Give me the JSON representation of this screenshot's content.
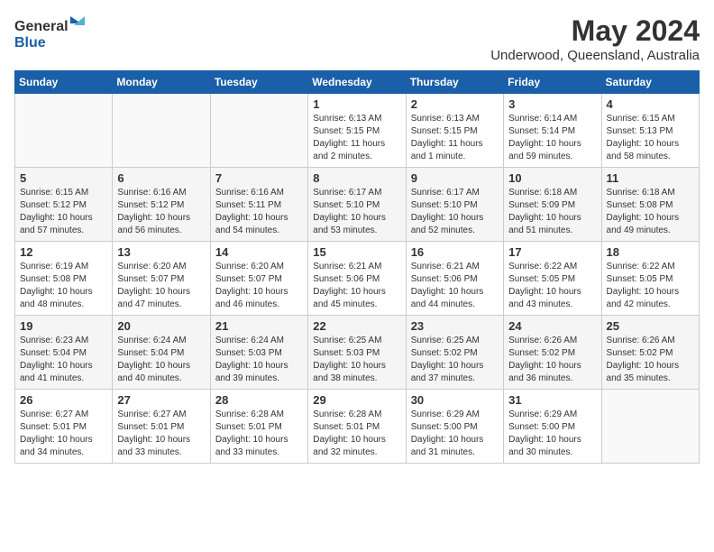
{
  "header": {
    "logo_general": "General",
    "logo_blue": "Blue",
    "month_year": "May 2024",
    "location": "Underwood, Queensland, Australia"
  },
  "days_of_week": [
    "Sunday",
    "Monday",
    "Tuesday",
    "Wednesday",
    "Thursday",
    "Friday",
    "Saturday"
  ],
  "weeks": [
    [
      {
        "day": "",
        "info": ""
      },
      {
        "day": "",
        "info": ""
      },
      {
        "day": "",
        "info": ""
      },
      {
        "day": "1",
        "info": "Sunrise: 6:13 AM\nSunset: 5:15 PM\nDaylight: 11 hours\nand 2 minutes."
      },
      {
        "day": "2",
        "info": "Sunrise: 6:13 AM\nSunset: 5:15 PM\nDaylight: 11 hours\nand 1 minute."
      },
      {
        "day": "3",
        "info": "Sunrise: 6:14 AM\nSunset: 5:14 PM\nDaylight: 10 hours\nand 59 minutes."
      },
      {
        "day": "4",
        "info": "Sunrise: 6:15 AM\nSunset: 5:13 PM\nDaylight: 10 hours\nand 58 minutes."
      }
    ],
    [
      {
        "day": "5",
        "info": "Sunrise: 6:15 AM\nSunset: 5:12 PM\nDaylight: 10 hours\nand 57 minutes."
      },
      {
        "day": "6",
        "info": "Sunrise: 6:16 AM\nSunset: 5:12 PM\nDaylight: 10 hours\nand 56 minutes."
      },
      {
        "day": "7",
        "info": "Sunrise: 6:16 AM\nSunset: 5:11 PM\nDaylight: 10 hours\nand 54 minutes."
      },
      {
        "day": "8",
        "info": "Sunrise: 6:17 AM\nSunset: 5:10 PM\nDaylight: 10 hours\nand 53 minutes."
      },
      {
        "day": "9",
        "info": "Sunrise: 6:17 AM\nSunset: 5:10 PM\nDaylight: 10 hours\nand 52 minutes."
      },
      {
        "day": "10",
        "info": "Sunrise: 6:18 AM\nSunset: 5:09 PM\nDaylight: 10 hours\nand 51 minutes."
      },
      {
        "day": "11",
        "info": "Sunrise: 6:18 AM\nSunset: 5:08 PM\nDaylight: 10 hours\nand 49 minutes."
      }
    ],
    [
      {
        "day": "12",
        "info": "Sunrise: 6:19 AM\nSunset: 5:08 PM\nDaylight: 10 hours\nand 48 minutes."
      },
      {
        "day": "13",
        "info": "Sunrise: 6:20 AM\nSunset: 5:07 PM\nDaylight: 10 hours\nand 47 minutes."
      },
      {
        "day": "14",
        "info": "Sunrise: 6:20 AM\nSunset: 5:07 PM\nDaylight: 10 hours\nand 46 minutes."
      },
      {
        "day": "15",
        "info": "Sunrise: 6:21 AM\nSunset: 5:06 PM\nDaylight: 10 hours\nand 45 minutes."
      },
      {
        "day": "16",
        "info": "Sunrise: 6:21 AM\nSunset: 5:06 PM\nDaylight: 10 hours\nand 44 minutes."
      },
      {
        "day": "17",
        "info": "Sunrise: 6:22 AM\nSunset: 5:05 PM\nDaylight: 10 hours\nand 43 minutes."
      },
      {
        "day": "18",
        "info": "Sunrise: 6:22 AM\nSunset: 5:05 PM\nDaylight: 10 hours\nand 42 minutes."
      }
    ],
    [
      {
        "day": "19",
        "info": "Sunrise: 6:23 AM\nSunset: 5:04 PM\nDaylight: 10 hours\nand 41 minutes."
      },
      {
        "day": "20",
        "info": "Sunrise: 6:24 AM\nSunset: 5:04 PM\nDaylight: 10 hours\nand 40 minutes."
      },
      {
        "day": "21",
        "info": "Sunrise: 6:24 AM\nSunset: 5:03 PM\nDaylight: 10 hours\nand 39 minutes."
      },
      {
        "day": "22",
        "info": "Sunrise: 6:25 AM\nSunset: 5:03 PM\nDaylight: 10 hours\nand 38 minutes."
      },
      {
        "day": "23",
        "info": "Sunrise: 6:25 AM\nSunset: 5:02 PM\nDaylight: 10 hours\nand 37 minutes."
      },
      {
        "day": "24",
        "info": "Sunrise: 6:26 AM\nSunset: 5:02 PM\nDaylight: 10 hours\nand 36 minutes."
      },
      {
        "day": "25",
        "info": "Sunrise: 6:26 AM\nSunset: 5:02 PM\nDaylight: 10 hours\nand 35 minutes."
      }
    ],
    [
      {
        "day": "26",
        "info": "Sunrise: 6:27 AM\nSunset: 5:01 PM\nDaylight: 10 hours\nand 34 minutes."
      },
      {
        "day": "27",
        "info": "Sunrise: 6:27 AM\nSunset: 5:01 PM\nDaylight: 10 hours\nand 33 minutes."
      },
      {
        "day": "28",
        "info": "Sunrise: 6:28 AM\nSunset: 5:01 PM\nDaylight: 10 hours\nand 33 minutes."
      },
      {
        "day": "29",
        "info": "Sunrise: 6:28 AM\nSunset: 5:01 PM\nDaylight: 10 hours\nand 32 minutes."
      },
      {
        "day": "30",
        "info": "Sunrise: 6:29 AM\nSunset: 5:00 PM\nDaylight: 10 hours\nand 31 minutes."
      },
      {
        "day": "31",
        "info": "Sunrise: 6:29 AM\nSunset: 5:00 PM\nDaylight: 10 hours\nand 30 minutes."
      },
      {
        "day": "",
        "info": ""
      }
    ]
  ]
}
